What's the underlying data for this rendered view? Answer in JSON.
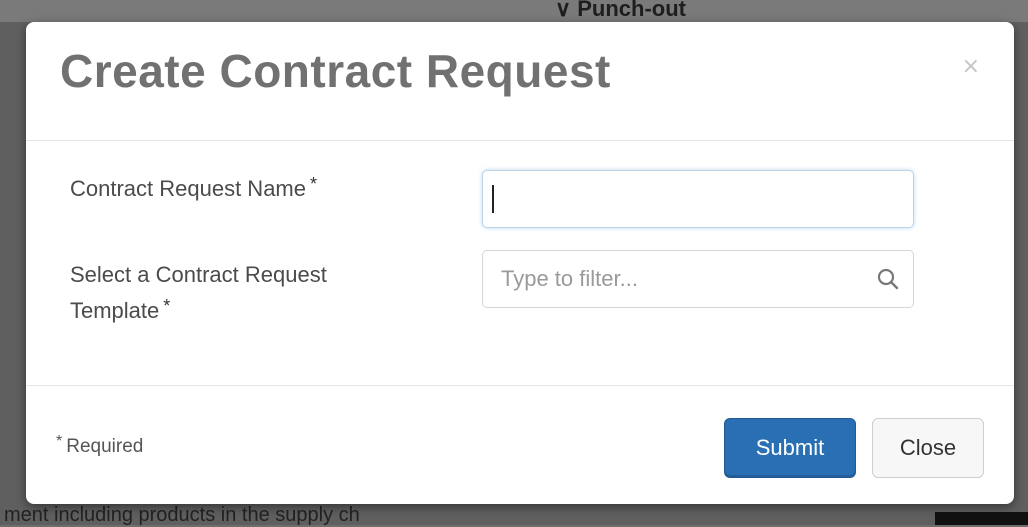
{
  "background": {
    "top_text": "∨ Punch-out",
    "bottom_text": "ment including products in the supply ch"
  },
  "dialog": {
    "title": "Create Contract Request",
    "close_icon": "×",
    "fields": {
      "name_label": "Contract Request Name",
      "name_value": "",
      "template_label": "Select a Contract Request Template",
      "template_placeholder": "Type to filter...",
      "required_star": "*"
    },
    "footer": {
      "required_note": "Required",
      "submit_label": "Submit",
      "close_label": "Close"
    }
  },
  "colors": {
    "primary": "#2a6fb3",
    "title": "#717171"
  },
  "icons": {
    "search": "search-icon",
    "close": "close-icon",
    "required": "required-star-icon"
  }
}
